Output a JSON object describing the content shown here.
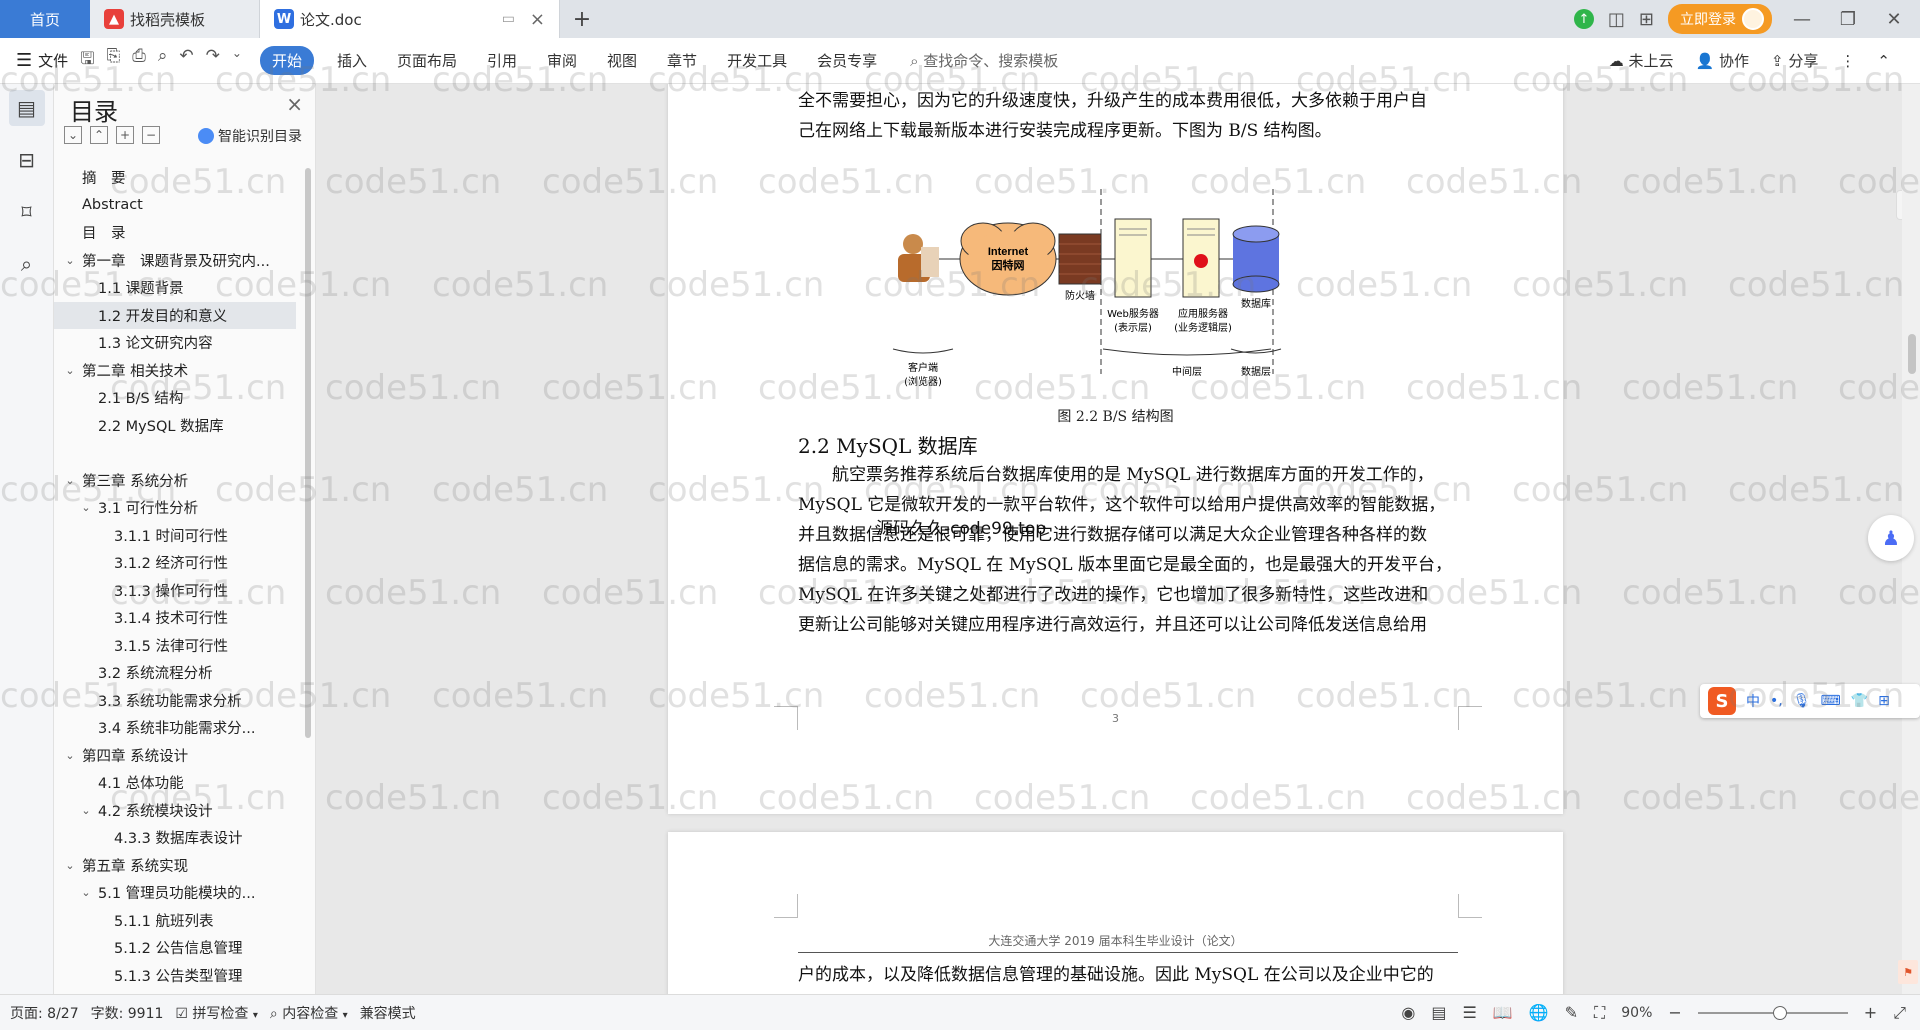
{
  "tabs": {
    "home": "首页",
    "tab1": "找稻壳模板",
    "tab2": "论文.doc",
    "login": "立即登录"
  },
  "menu": {
    "file": "文件",
    "items": [
      "开始",
      "插入",
      "页面布局",
      "引用",
      "审阅",
      "视图",
      "章节",
      "开发工具",
      "会员专享"
    ],
    "search": "查找命令、搜索模板",
    "cloud": "未上云",
    "collab": "协作",
    "share": "分享"
  },
  "toc": {
    "title": "目录",
    "smart": "智能识别目录",
    "items": [
      {
        "label": "摘　要",
        "level": 0,
        "arrow": ""
      },
      {
        "label": "Abstract",
        "level": 0,
        "arrow": ""
      },
      {
        "label": "目　录",
        "level": 0,
        "arrow": ""
      },
      {
        "label": "第一章　课题背景及研究内...",
        "level": 0,
        "arrow": "v"
      },
      {
        "label": "1.1  课题背景",
        "level": 1,
        "arrow": ""
      },
      {
        "label": "1.2  开发目的和意义",
        "level": 1,
        "arrow": "",
        "selected": true
      },
      {
        "label": "1.3  论文研究内容",
        "level": 1,
        "arrow": ""
      },
      {
        "label": "第二章  相关技术",
        "level": 0,
        "arrow": "v"
      },
      {
        "label": "2.1  B/S 结构",
        "level": 1,
        "arrow": ""
      },
      {
        "label": "2.2  MySQL 数据库",
        "level": 1,
        "arrow": ""
      },
      {
        "label": "",
        "level": 1,
        "arrow": ""
      },
      {
        "label": "第三章  系统分析",
        "level": 0,
        "arrow": "v"
      },
      {
        "label": "3.1 可行性分析",
        "level": 1,
        "arrow": "v"
      },
      {
        "label": "3.1.1 时间可行性",
        "level": 2,
        "arrow": ""
      },
      {
        "label": "3.1.2  经济可行性",
        "level": 2,
        "arrow": ""
      },
      {
        "label": "3.1.3  操作可行性",
        "level": 2,
        "arrow": ""
      },
      {
        "label": "3.1.4  技术可行性",
        "level": 2,
        "arrow": ""
      },
      {
        "label": "3.1.5  法律可行性",
        "level": 2,
        "arrow": ""
      },
      {
        "label": "3.2 系统流程分析",
        "level": 1,
        "arrow": ""
      },
      {
        "label": "3.3 系统功能需求分析",
        "level": 1,
        "arrow": ""
      },
      {
        "label": "3.4  系统非功能需求分...",
        "level": 1,
        "arrow": ""
      },
      {
        "label": "第四章  系统设计",
        "level": 0,
        "arrow": "v"
      },
      {
        "label": "4.1  总体功能",
        "level": 1,
        "arrow": ""
      },
      {
        "label": "4.2  系统模块设计",
        "level": 1,
        "arrow": "v"
      },
      {
        "label": "4.3.3  数据库表设计",
        "level": 2,
        "arrow": ""
      },
      {
        "label": "第五章  系统实现",
        "level": 0,
        "arrow": "v"
      },
      {
        "label": "5.1  管理员功能模块的...",
        "level": 1,
        "arrow": "v"
      },
      {
        "label": "5.1.1  航班列表",
        "level": 2,
        "arrow": ""
      },
      {
        "label": "5.1.2  公告信息管理",
        "level": 2,
        "arrow": ""
      },
      {
        "label": "5.1.3  公告类型管理",
        "level": 2,
        "arrow": ""
      }
    ]
  },
  "doc": {
    "para1_line1": "全不需要担心，因为它的升级速度快，升级产生的成本费用很低，大多依赖于用户自",
    "para1_line2": "己在网络上下载最新版本进行安装完成程序更新。下图为 B/S 结构图。",
    "diagram": {
      "internet": "Internet",
      "internet_cn": "因特网",
      "firewall": "防火墙",
      "web_server": "Web服务器",
      "web_server_sub": "(表示层)",
      "app_server": "应用服务器",
      "app_server_sub": "(业务逻辑层)",
      "database": "数据库",
      "client": "客户端",
      "client_sub": "(浏览器)",
      "middle": "中间层",
      "data_layer": "数据层"
    },
    "figure_caption": "图 2.2 B/S 结构图",
    "heading": "2.2 MySQL 数据库",
    "para2": [
      "　　航空票务推荐系统后台数据库使用的是 MySQL 进行数据库方面的开发工作的，",
      "MySQL 它是微软开发的一款平台软件，这个软件可以给用户提供高效率的智能数据，",
      "并且数据信息还是很可靠，使用它进行数据存储可以满足大众企业管理各种各样的数",
      "据信息的需求。MySQL 在 MySQL 版本里面它是最全面的，也是最强大的开发平台，",
      "MySQL 在许多关键之处都进行了改进的操作，它也增加了很多新特性，这些改进和",
      "更新让公司能够对关键应用程序进行高效运行，并且还可以让公司降低发送信息给用"
    ],
    "overlay": "源码久久-code99.top",
    "page_number": "3",
    "page2_header": "大连交通大学 2019 届本科生毕业设计（论文）",
    "page2_line": "户的成本，以及降低数据信息管理的基础设施。因此 MySQL 在公司以及企业中它的"
  },
  "ime": {
    "logo": "S",
    "mode": "中"
  },
  "status": {
    "page": "页面: 8/27",
    "words": "字数: 9911",
    "spell": "拼写检查",
    "content": "内容检查",
    "compat": "兼容模式",
    "zoom": "90%"
  },
  "watermark": "code51.cn",
  "colors": {
    "accent": "#3a7bd5",
    "login": "#f59a23"
  }
}
